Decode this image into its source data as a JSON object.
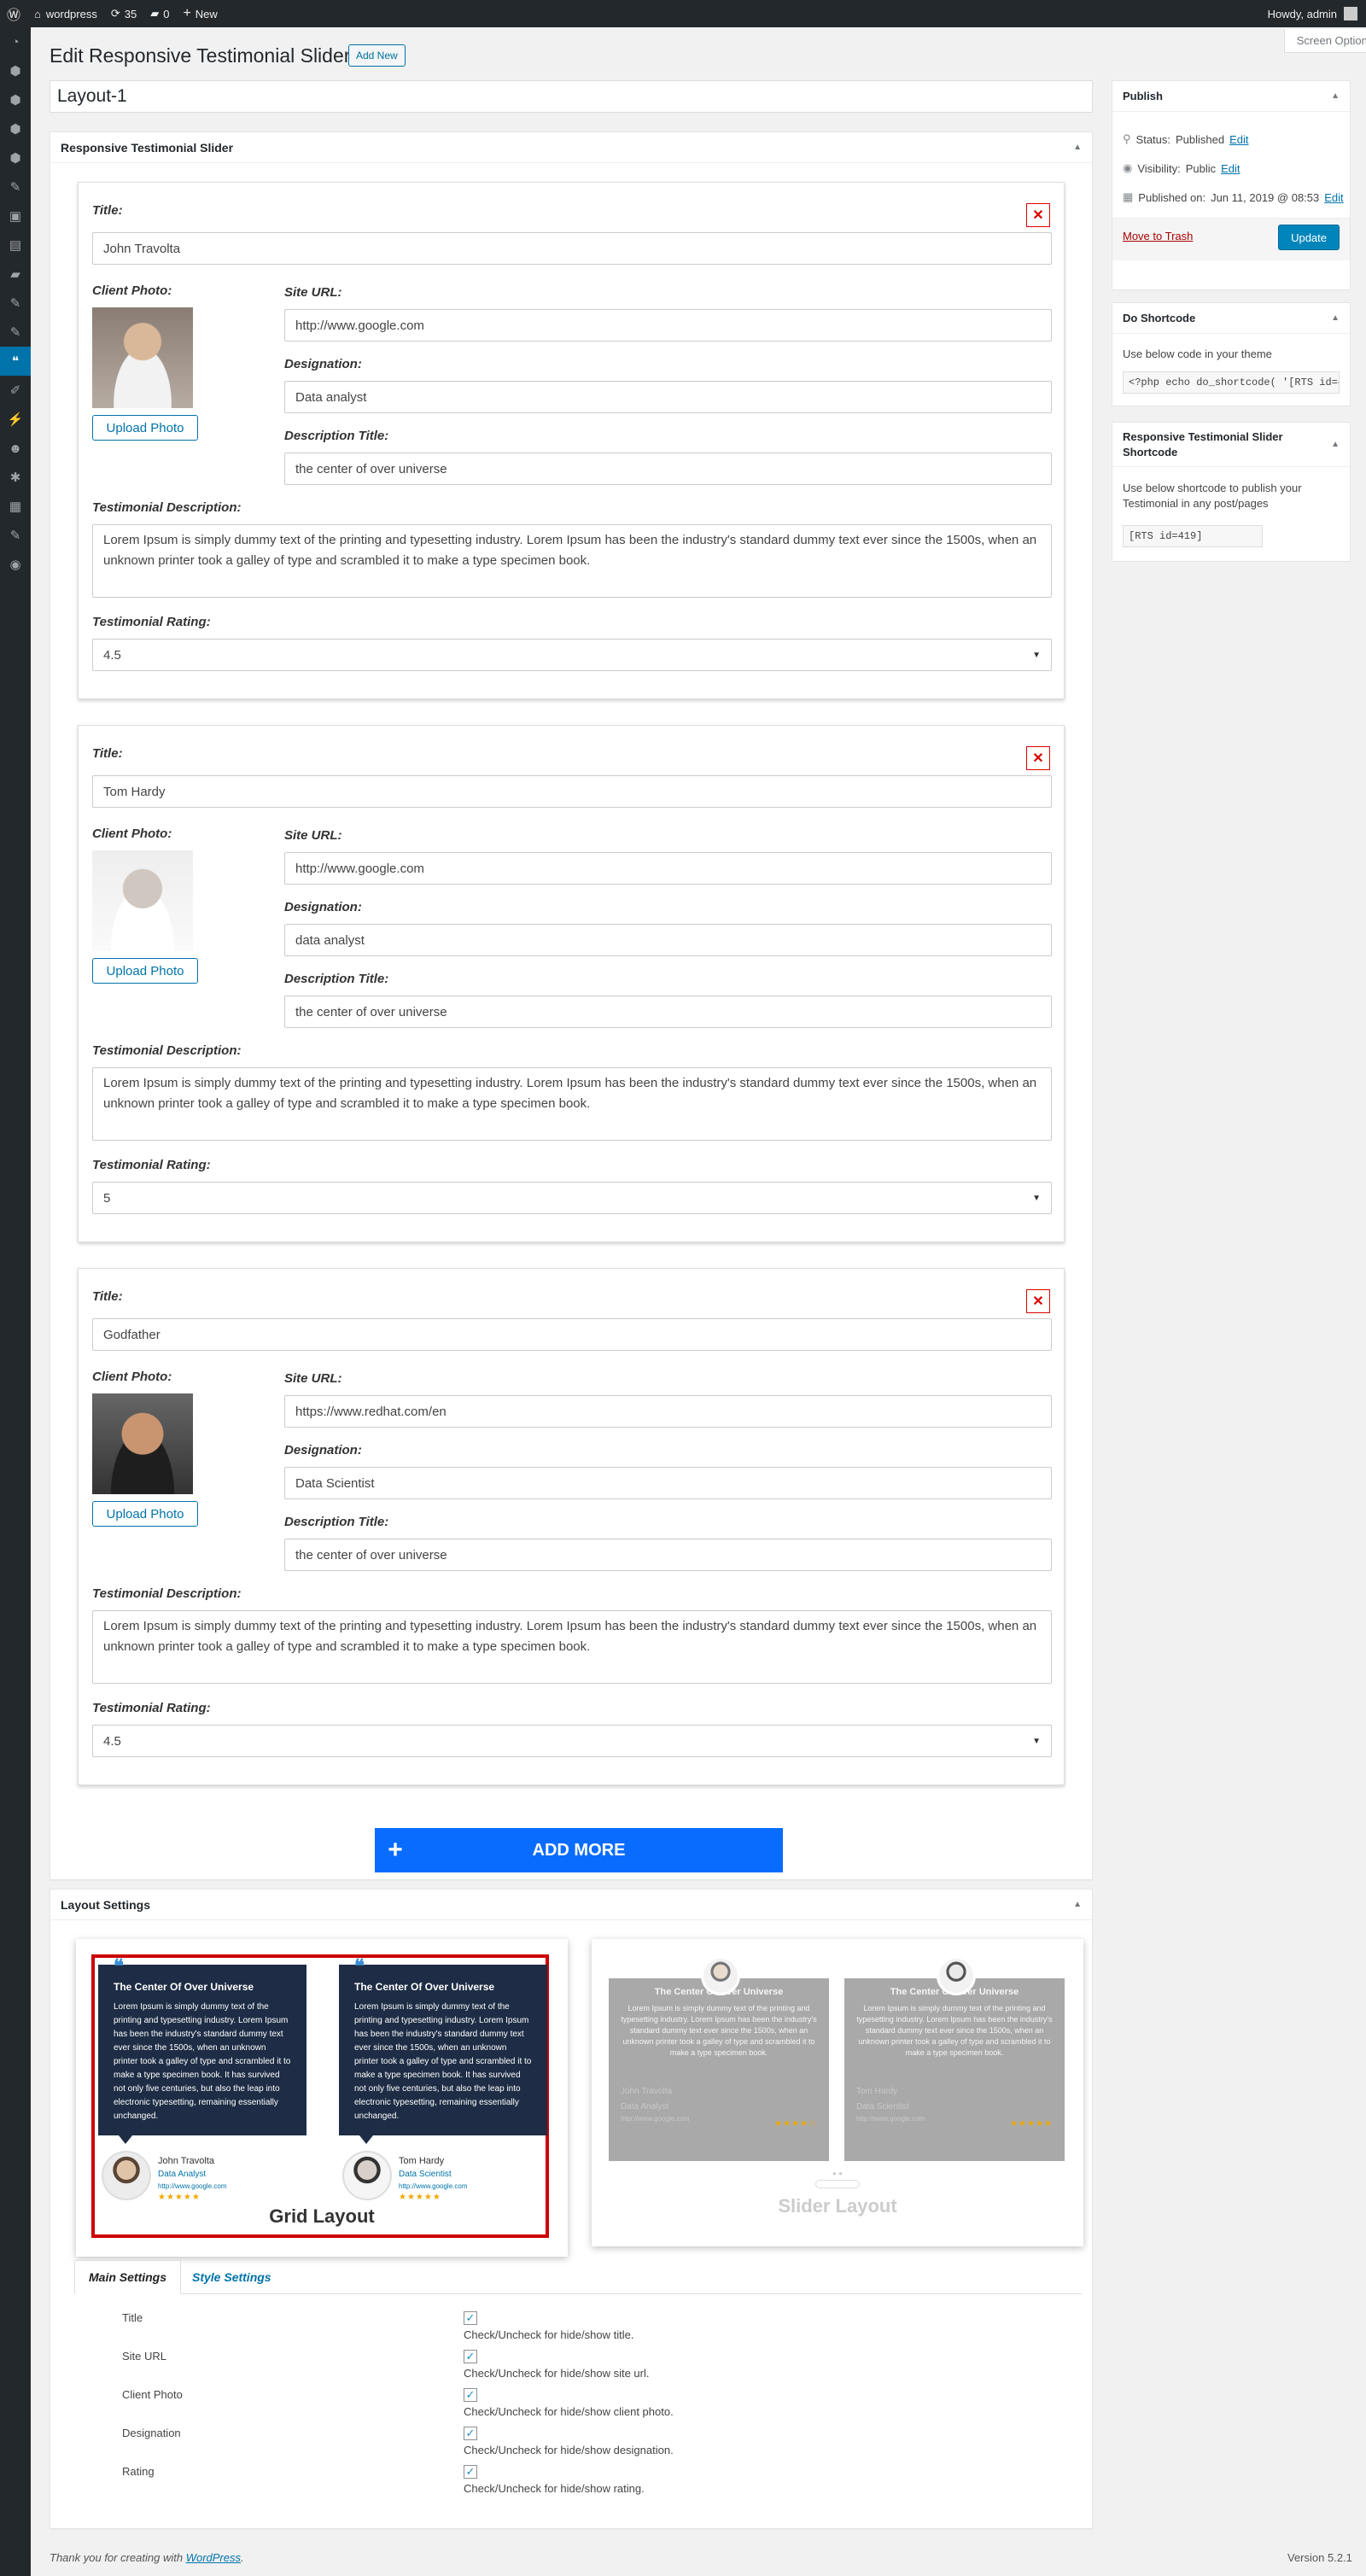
{
  "adminbar": {
    "site": "wordpress",
    "updates": "35",
    "comments": "0",
    "new_label": "New",
    "howdy": "Howdy, admin"
  },
  "screen_options": "Screen Options",
  "page": {
    "title": "Edit Responsive Testimonial Slider",
    "add_new": "Add New",
    "post_title": "Layout-1"
  },
  "metabox": {
    "title": "Responsive Testimonial Slider"
  },
  "labels": {
    "title": "Title:",
    "client_photo": "Client Photo:",
    "site_url": "Site URL:",
    "designation": "Designation:",
    "description_title": "Description Title:",
    "testimonial_description": "Testimonial Description:",
    "testimonial_rating": "Testimonial Rating:",
    "upload_photo": "Upload Photo",
    "delete": "✕"
  },
  "testimonials": [
    {
      "title": "John Travolta",
      "site_url": "http://www.google.com",
      "designation": "Data analyst",
      "description_title": "the center of over universe",
      "description": "Lorem Ipsum is simply dummy text of the printing and typesetting industry. Lorem Ipsum has been the industry's standard dummy text ever since the 1500s, when an unknown printer took a galley of type and scrambled it to make a type specimen book.",
      "rating": "4.5"
    },
    {
      "title": "Tom Hardy",
      "site_url": "http://www.google.com",
      "designation": "data analyst",
      "description_title": "the center of over universe",
      "description": "Lorem Ipsum is simply dummy text of the printing and typesetting industry. Lorem Ipsum has been the industry's standard dummy text ever since the 1500s, when an unknown printer took a galley of type and scrambled it to make a type specimen book.",
      "rating": "5"
    },
    {
      "title": "Godfather",
      "site_url": "https://www.redhat.com/en",
      "designation": "Data Scientist",
      "description_title": "the center of over universe",
      "description": "Lorem Ipsum is simply dummy text of the printing and typesetting industry. Lorem Ipsum has been the industry's standard dummy text ever since the 1500s, when an unknown printer took a galley of type and scrambled it to make a type specimen book.",
      "rating": "4.5"
    }
  ],
  "add_more": {
    "plus": "+",
    "label": "ADD MORE"
  },
  "publish": {
    "title": "Publish",
    "status_label": "Status:",
    "status": "Published",
    "visibility_label": "Visibility:",
    "visibility": "Public",
    "published_label": "Published on:",
    "published_on": "Jun 11, 2019 @ 08:53",
    "edit": "Edit",
    "trash": "Move to Trash",
    "update": "Update"
  },
  "do_shortcode": {
    "title": "Do Shortcode",
    "text": "Use below code in your theme",
    "code": "<?php echo do_shortcode( '[RTS id=419]' ); ?>"
  },
  "slider_shortcode": {
    "title": "Responsive Testimonial Slider Shortcode",
    "text": "Use below shortcode to publish your Testimonial in any post/pages",
    "code": "[RTS id=419]"
  },
  "layout_settings": {
    "title": "Layout Settings",
    "grid_label": "Grid Layout",
    "slider_label": "Slider Layout",
    "preview": {
      "heading": "The Center Of Over Universe",
      "grid_text": "Lorem Ipsum is simply dummy text of the printing and typesetting industry. Lorem Ipsum has been the industry's standard dummy text ever since the 1500s, when an unknown printer took a galley of type and scrambled it to make a type specimen book. It has survived not only five centuries, but also the leap into electronic typesetting, remaining essentially unchanged.",
      "slider_text": "Lorem Ipsum is simply dummy text of the printing and typesetting industry. Lorem Ipsum has been the industry's standard dummy text ever since the 1500s, when an unknown printer took a galley of type and scrambled it to make a type specimen book.",
      "p1_name": "John Travolta",
      "p1_role": "Data Analyst",
      "p2_name": "Tom Hardy",
      "p2_role": "Data Scientist",
      "url": "http://www.google.com",
      "stars": "★★★★★",
      "stars_half": "★★★★☆"
    }
  },
  "settings_tabs": {
    "main": "Main Settings",
    "style": "Style Settings"
  },
  "settings": [
    {
      "name": "Title",
      "desc": "Check/Uncheck for hide/show title."
    },
    {
      "name": "Site URL",
      "desc": "Check/Uncheck for hide/show site url."
    },
    {
      "name": "Client Photo",
      "desc": "Check/Uncheck for hide/show client photo."
    },
    {
      "name": "Designation",
      "desc": "Check/Uncheck for hide/show designation."
    },
    {
      "name": "Rating",
      "desc": "Check/Uncheck for hide/show rating."
    }
  ],
  "checkmark": "✓",
  "footer": {
    "thanks": "Thank you for creating with",
    "wp": "WordPress",
    "period": ".",
    "version": "Version 5.2.1"
  },
  "colors": {
    "accent": "#0073aa",
    "add_more": "#0a6cff",
    "grid_card": "#1e2d45",
    "slider_card": "#a9a9a9",
    "selected_border": "#cc0000"
  }
}
